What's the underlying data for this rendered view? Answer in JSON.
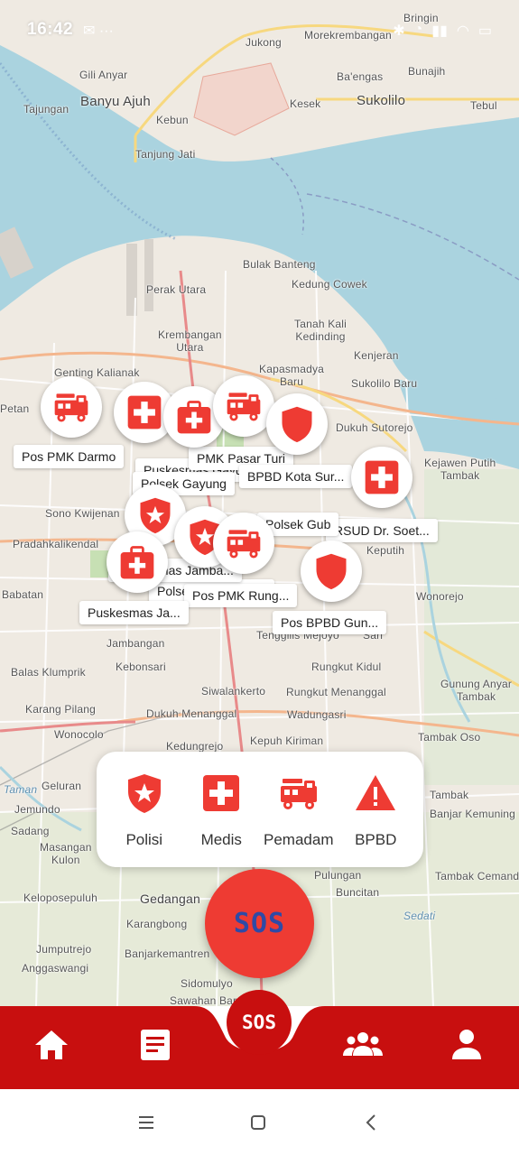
{
  "status_bar": {
    "time": "16:42",
    "left_icons": "✉ ···",
    "right_icons": [
      "bluetooth-icon",
      "alarm-icon",
      "signal-icon",
      "wifi-icon",
      "battery-icon"
    ]
  },
  "map": {
    "places": {
      "bringin": "Bringin",
      "jukong": "Jukong",
      "morekrembangan": "Morekrembangan",
      "gili_anyar": "Gili Anyar",
      "ba_engas": "Ba'engas",
      "bunajih": "Bunajih",
      "tajungan": "Tajungan",
      "banyu_ajuh": "Banyu Ajuh",
      "kesek": "Kesek",
      "sukolilo": "Sukolilo",
      "tebul": "Tebul",
      "kebun": "Kebun",
      "tanjung_jati": "Tanjung Jati",
      "bulak_banteng": "Bulak Banteng",
      "kedung_cowek": "Kedung Cowek",
      "perak_utara": "Perak Utara",
      "tanah_kali_kedinding": "Tanah Kali\nKedinding",
      "krembangan_utara": "Krembangan\nUtara",
      "kenjeran": "Kenjeran",
      "kapasmadya_baru": "Kapasmadya\nBaru",
      "sukolilo_baru": "Sukolilo Baru",
      "genting_kalianak": "Genting Kalianak",
      "dukuh_sutorejo": "Dukuh Sutorejo",
      "kejawen_putih_tambak": "Kejawen Putih\nTambak",
      "petan": "Petan",
      "sono_kwijenan": "Sono Kwijenan",
      "pradahkali_kendal": "Pradahkalikendal",
      "babatan": "Babatan",
      "keputih": "Keputih",
      "wonorejo": "Wonorejo",
      "jambangan": "Jambangan",
      "kebonsari": "Kebonsari",
      "tenggilis_mejoyo": "Tenggilis Mejoyo",
      "sari": "Sari",
      "balas_klumprik": "Balas Klumprik",
      "siwalankerto": "Siwalankerto",
      "rungkut_kidul": "Rungkut Kidul",
      "rungkut_menanggal": "Rungkut Menanggal",
      "gunung_anyar_tambak": "Gunung Anyar\nTambak",
      "karang_pilang": "Karang Pilang",
      "dukuh_menanggal": "Dukuh Menanggal",
      "wadungasri": "Wadungasri",
      "wonocolo": "Wonocolo",
      "tambak_oso": "Tambak Oso",
      "kedungrejo": "Kedungrejo",
      "kepuh_kiriman": "Kepuh Kiriman",
      "taman": "Taman",
      "geluran": "Geluran",
      "jemundo": "Jemundo",
      "sadang": "Sadang",
      "masangan_kulon": "Masangan\nKulon",
      "tambak": "Tambak",
      "banjar_kemuning": "Banjar Kemuning",
      "pulungan": "Pulungan",
      "buncitan": "Buncitan",
      "tambak_cemandi": "Tambak Cemandi",
      "keloposepuluh": "Keloposepuluh",
      "gedangan": "Gedangan",
      "sedati": "Sedati",
      "karangbong": "Karangbong",
      "jumputrejo": "Jumputrejo",
      "banjarkemantren": "Banjarkemantren",
      "anggaswangi": "Anggaswangi",
      "sidomulyo": "Sidomulyo",
      "sawahan_baru": "Sawahan Baru"
    },
    "markers": [
      {
        "type": "fire",
        "label": "Pos PMK Darmo"
      },
      {
        "type": "medical",
        "label": "Puskesmas Gayung"
      },
      {
        "type": "medical",
        "label": "Polsek Gayung"
      },
      {
        "type": "fire",
        "label": "PMK Pasar Turi"
      },
      {
        "type": "police",
        "label": "BPBD Kota Sur..."
      },
      {
        "type": "medical",
        "label": "RSUD Dr. Soet..."
      },
      {
        "type": "police",
        "label": "Polsek Gub"
      },
      {
        "type": "police",
        "label": "Polsek Wonokromo"
      },
      {
        "type": "fire",
        "label": "Pos PMK Rung..."
      },
      {
        "type": "medical",
        "label": "Puskesmas Ja..."
      },
      {
        "type": "police",
        "label": "Pos BPBD Gun..."
      },
      {
        "type": "medical",
        "label": "Puskesmas Jamba..."
      }
    ]
  },
  "filter": {
    "items": [
      {
        "label": "Polisi",
        "icon": "police-shield-icon"
      },
      {
        "label": "Medis",
        "icon": "medical-cross-icon"
      },
      {
        "label": "Pemadam",
        "icon": "fire-truck-icon"
      },
      {
        "label": "BPBD",
        "icon": "warning-icon"
      }
    ]
  },
  "sos": {
    "big_label": "SOS",
    "nav_label": "SOS"
  },
  "bottom_nav": {
    "items": [
      "home-icon",
      "news-icon",
      "sos",
      "group-icon",
      "profile-icon"
    ]
  },
  "colors": {
    "accent_red": "#ee3b33",
    "nav_red": "#c80f0f",
    "sos_text_blue": "#2f4aa6",
    "water": "#aad3df",
    "land": "#efeae2"
  }
}
